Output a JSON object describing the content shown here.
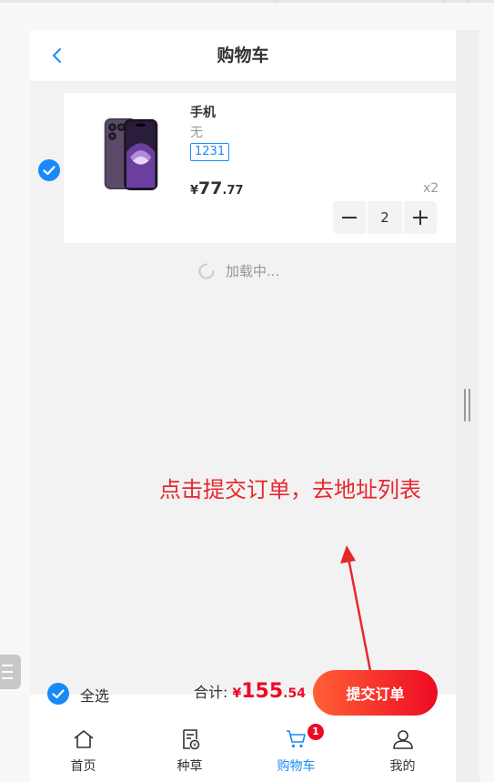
{
  "header": {
    "title": "购物车"
  },
  "cart_item": {
    "title": "手机",
    "desc": "无",
    "tag": "1231",
    "price_symbol": "¥",
    "price_int": "77",
    "price_dec": ".77",
    "num": "x2",
    "quantity": "2",
    "checked": true
  },
  "loading": {
    "text": "加载中..."
  },
  "annotation": {
    "text": "点击提交订单，去地址列表"
  },
  "submit_bar": {
    "select_all_label": "全选",
    "total_label": "合计: ",
    "total_symbol": "¥",
    "total_int": "155",
    "total_dec": ".54",
    "button_label": "提交订单"
  },
  "tabbar": {
    "active_index": 2,
    "tabs": [
      {
        "label": "首页",
        "icon": "home-icon"
      },
      {
        "label": "种草",
        "icon": "receipt-icon"
      },
      {
        "label": "购物车",
        "icon": "cart-icon",
        "badge": "1"
      },
      {
        "label": "我的",
        "icon": "user-icon"
      }
    ]
  },
  "colors": {
    "primary": "#1989fa",
    "danger": "#ee0a24",
    "annotation": "#e8272b"
  }
}
